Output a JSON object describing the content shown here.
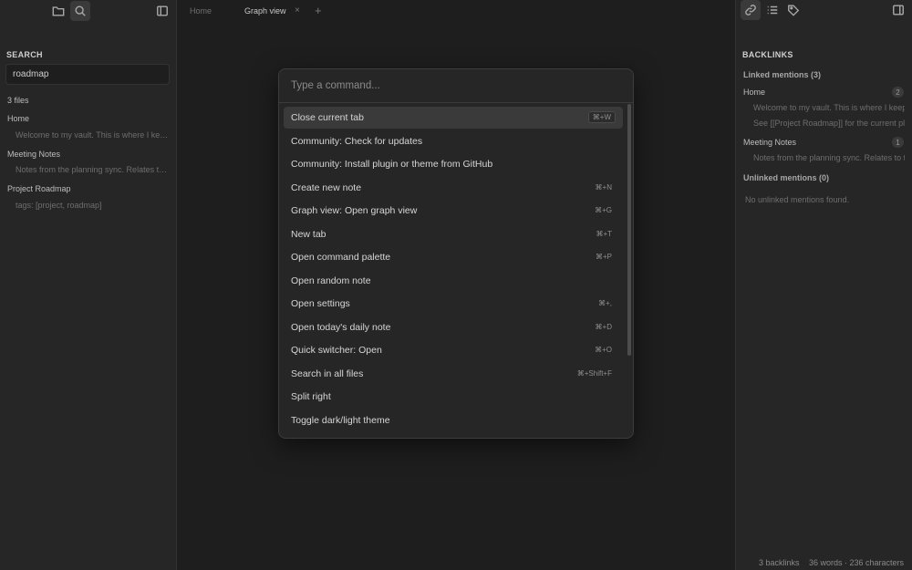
{
  "left_sidebar": {
    "icons": [
      "folder-icon",
      "search-icon",
      "sidebar-toggle-icon"
    ],
    "search": {
      "title": "SEARCH",
      "query": "roadmap",
      "result_count": "3 files",
      "results": [
        {
          "title": "Home",
          "snippet": "Welcome to my vault. This is where I keep my notes."
        },
        {
          "title": "Meeting Notes",
          "snippet": "Notes from the planning sync. Relates to the roadmap."
        },
        {
          "title": "Project Roadmap",
          "snippet": "tags: [project, roadmap]"
        }
      ]
    }
  },
  "tabs": {
    "items": [
      {
        "label": "Home",
        "active": false
      },
      {
        "label": "Graph view",
        "active": true
      }
    ],
    "close_glyph": "×",
    "add_glyph": "+"
  },
  "command_palette": {
    "placeholder": "Type a command...",
    "commands": [
      {
        "label": "Close current tab",
        "hotkey": "⌘+W",
        "selected": true
      },
      {
        "label": "Community: Check for updates",
        "hotkey": ""
      },
      {
        "label": "Community: Install plugin or theme from GitHub",
        "hotkey": ""
      },
      {
        "label": "Create new note",
        "hotkey": "⌘+N"
      },
      {
        "label": "Graph view: Open graph view",
        "hotkey": "⌘+G"
      },
      {
        "label": "New tab",
        "hotkey": "⌘+T"
      },
      {
        "label": "Open command palette",
        "hotkey": "⌘+P"
      },
      {
        "label": "Open random note",
        "hotkey": ""
      },
      {
        "label": "Open settings",
        "hotkey": "⌘+,"
      },
      {
        "label": "Open today's daily note",
        "hotkey": "⌘+D"
      },
      {
        "label": "Quick switcher: Open",
        "hotkey": "⌘+O"
      },
      {
        "label": "Search in all files",
        "hotkey": "⌘+Shift+F"
      },
      {
        "label": "Split right",
        "hotkey": ""
      },
      {
        "label": "Toggle dark/light theme",
        "hotkey": ""
      }
    ]
  },
  "right_sidebar": {
    "icons": [
      "link-icon",
      "list-icon",
      "tag-icon",
      "sidebar-toggle-icon"
    ],
    "title": "BACKLINKS",
    "linked_title": "Linked mentions (3)",
    "linked": [
      {
        "title": "Home",
        "count": "2",
        "snippets": [
          "Welcome to my vault. This is where I keep my notes.",
          "See [[Project Roadmap]] for the current plan."
        ]
      },
      {
        "title": "Meeting Notes",
        "count": "1",
        "snippets": [
          "Notes from the planning sync. Relates to the roadmap."
        ]
      }
    ],
    "unlinked_title": "Unlinked mentions (0)",
    "unlinked_empty": "No unlinked mentions found."
  },
  "status_bar": {
    "backlinks": "3 backlinks",
    "counts": "36 words · 236 characters"
  },
  "colors": {
    "background": "#1e1e1e",
    "sidebar": "#262626",
    "selected": "#3a3a3a"
  }
}
